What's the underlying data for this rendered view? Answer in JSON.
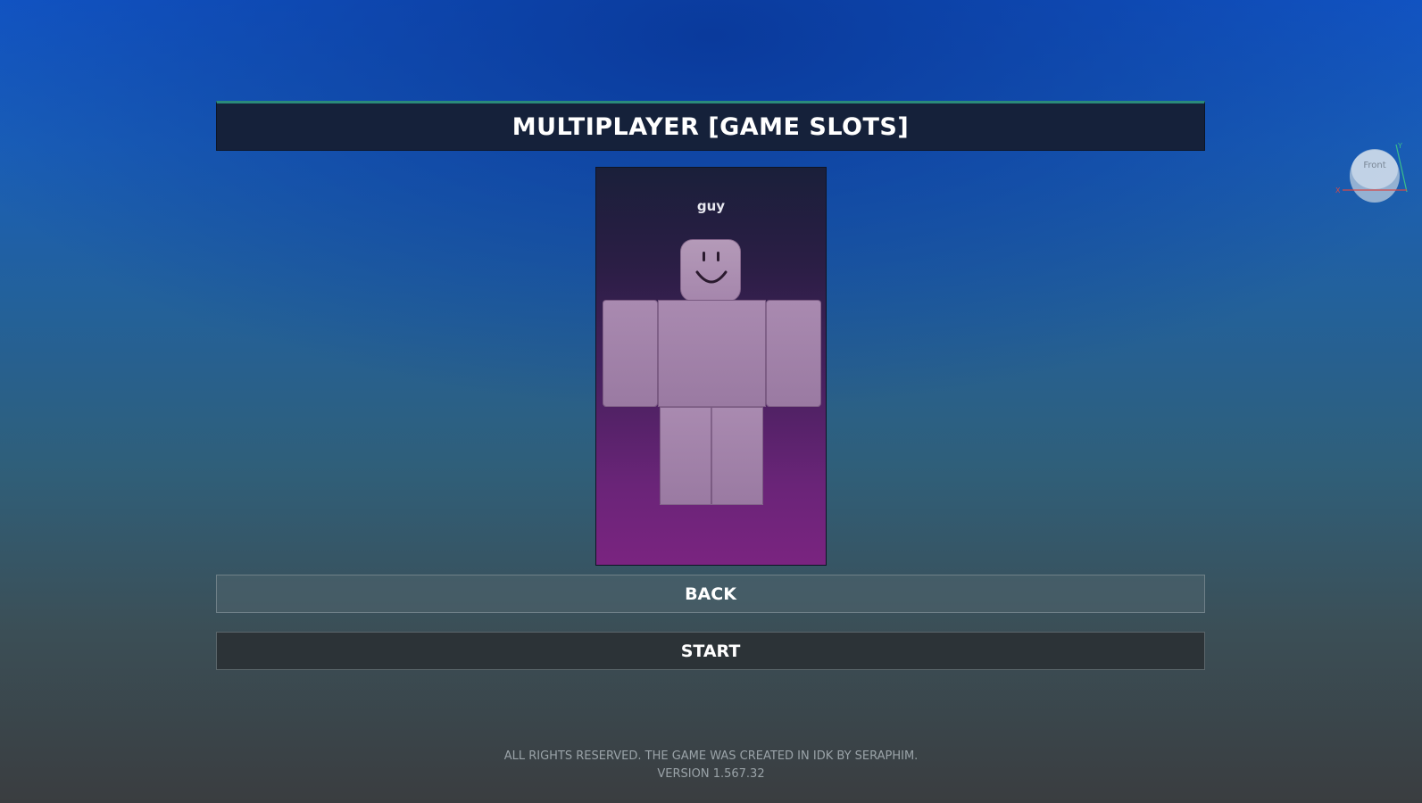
{
  "title": "MULTIPLAYER [GAME SLOTS]",
  "slot": {
    "player_name": "guy"
  },
  "buttons": {
    "back": "BACK",
    "start": "START"
  },
  "footer": {
    "copyright": "ALL RIGHTS RESERVED. THE GAME WAS CREATED IN IDK BY SERAPHIM.",
    "version": "VERSION 1.567.32"
  },
  "view_cube": {
    "face_label": "Front",
    "axis_x": "X",
    "axis_y": "Y"
  },
  "colors": {
    "title_bar": "#15213a",
    "title_accent": "#2a8a7a",
    "card_top": "#1a1f3a",
    "card_bottom": "#7a2480",
    "avatar": "#a98ab0"
  }
}
